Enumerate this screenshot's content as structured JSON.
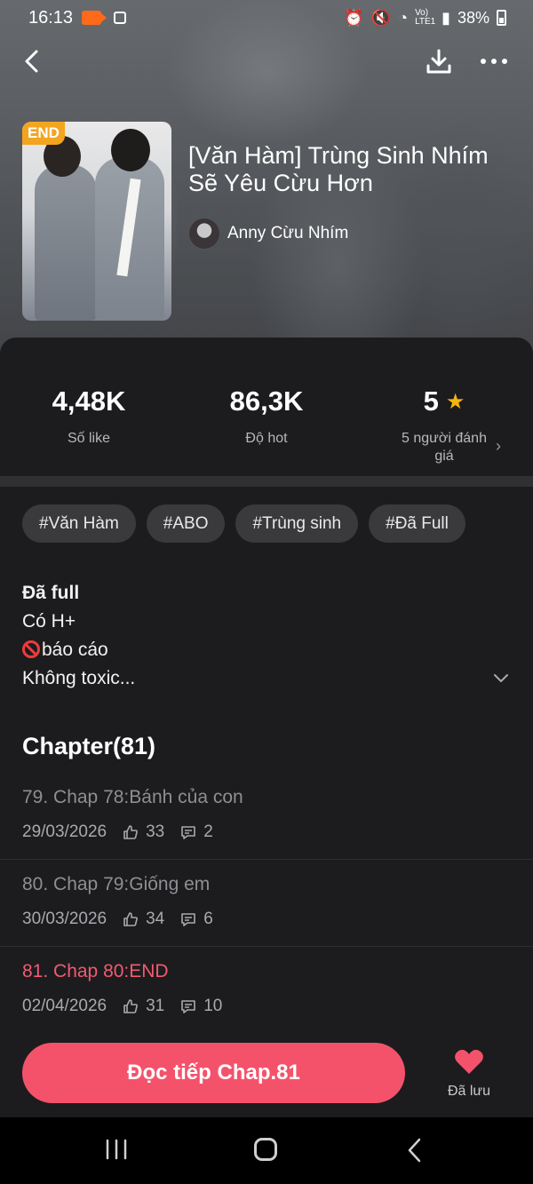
{
  "status_bar": {
    "time": "16:13",
    "network": "Vo) LTE1",
    "battery": "38%"
  },
  "cover": {
    "badge": "END"
  },
  "story": {
    "title": "[Văn Hàm] Trùng Sinh Nhím Sẽ Yêu Cừu Hơn",
    "author": "Anny Cừu Nhím"
  },
  "stats": [
    {
      "value": "4,48K",
      "label": "Số like"
    },
    {
      "value": "86,3K",
      "label": "Độ hot"
    },
    {
      "value": "5",
      "label": "5 người đánh giá"
    }
  ],
  "tags": [
    "#Văn Hàm",
    "#ABO",
    "#Trùng sinh",
    "#Đã Full"
  ],
  "description": {
    "line1": "Đã full",
    "line2": "Có H+",
    "line3": "báo cáo",
    "line4": "Không toxic..."
  },
  "chapters": {
    "header": "Chapter(81)",
    "items": [
      {
        "title": "79. Chap 78:Bánh của con",
        "date": "29/03/2026",
        "likes": "33",
        "comments": "2"
      },
      {
        "title": "80. Chap 79:Giống em",
        "date": "30/03/2026",
        "likes": "34",
        "comments": "6"
      },
      {
        "title": "81. Chap 80:END",
        "date": "02/04/2026",
        "likes": "31",
        "comments": "10"
      }
    ]
  },
  "actions": {
    "read_button": "Đọc tiếp Chap.81",
    "save_label": "Đã lưu"
  },
  "colors": {
    "accent": "#f4526b",
    "star": "#f6b40e",
    "badge": "#f3a51f",
    "background": "#1c1c1e"
  },
  "icons": [
    "back-icon",
    "download-icon",
    "more-icon",
    "star-icon",
    "chevron-right-icon",
    "chevron-down-icon",
    "like-icon",
    "comment-icon",
    "heart-icon",
    "recent-apps-icon",
    "home-icon",
    "nav-back-icon"
  ]
}
